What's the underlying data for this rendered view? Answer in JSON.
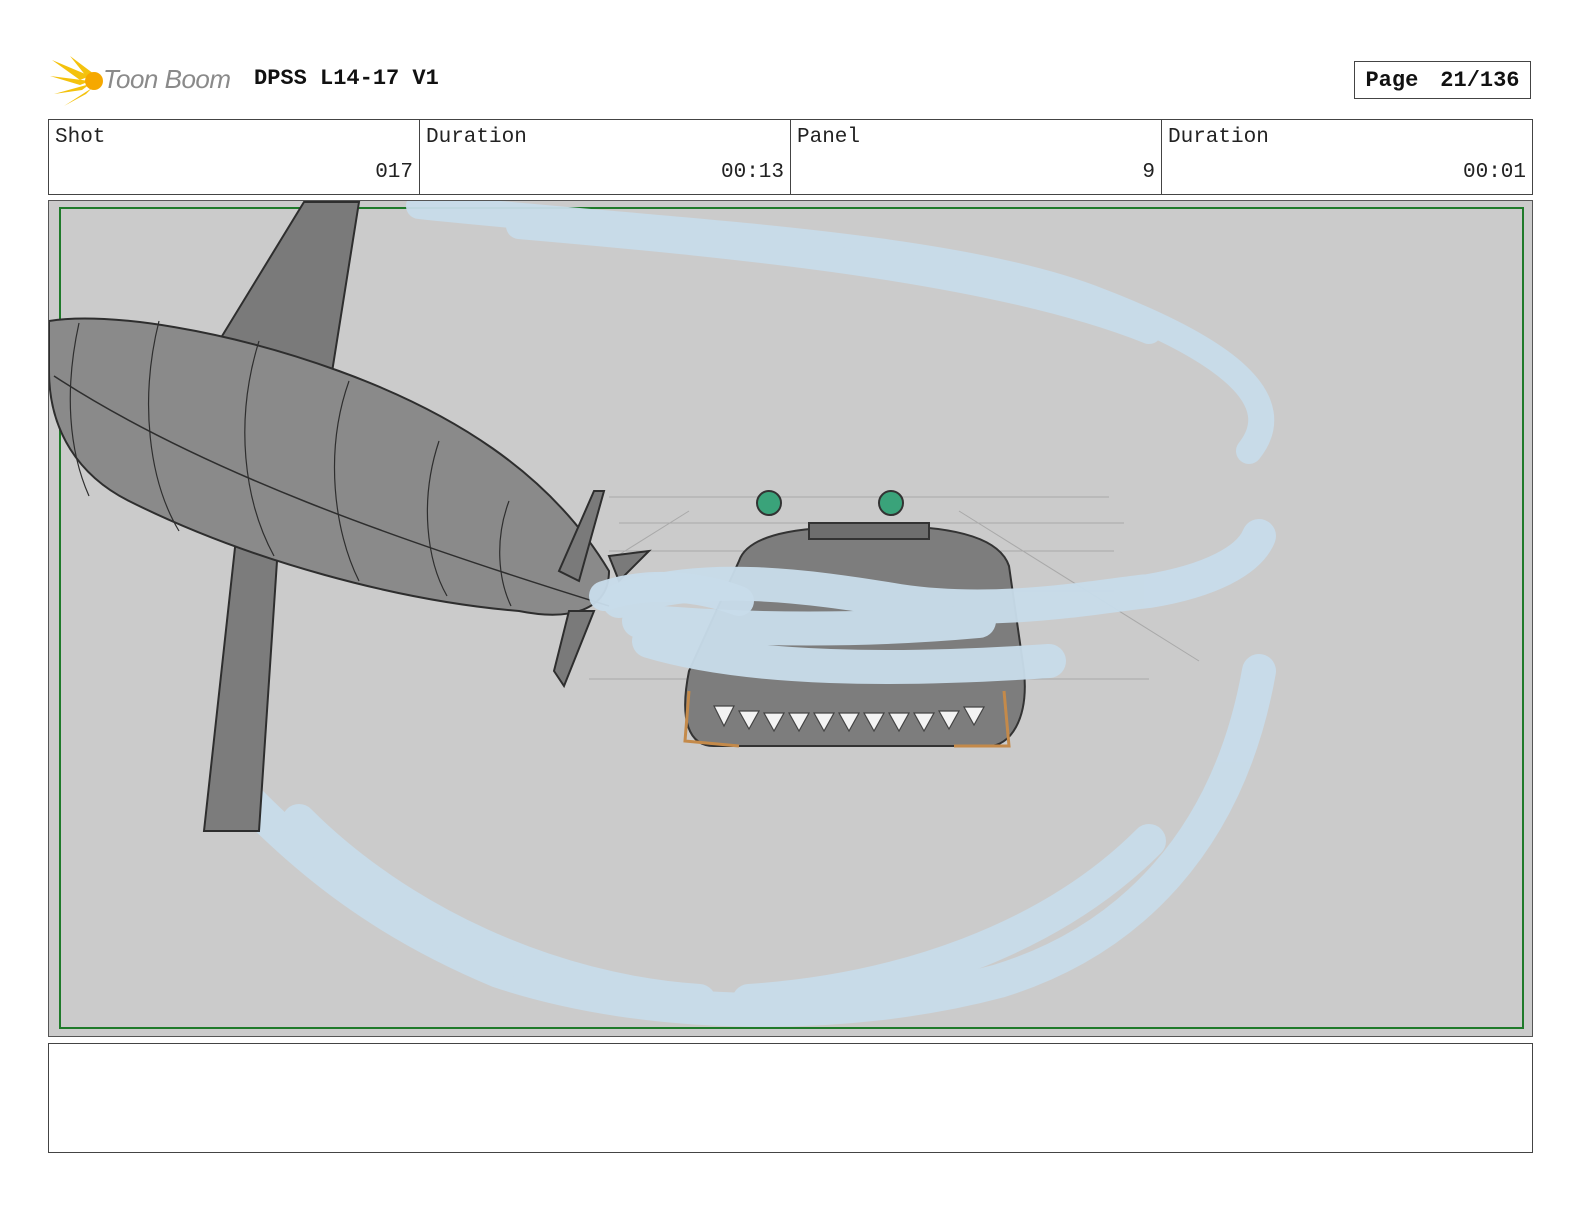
{
  "header": {
    "logo_text": "Toon Boom",
    "project_title": "DPSS L14-17 V1",
    "page_label": "Page",
    "page_value": "21/136"
  },
  "info": {
    "shot_label": "Shot",
    "shot_value": "017",
    "shot_duration_label": "Duration",
    "shot_duration_value": "00:13",
    "panel_label": "Panel",
    "panel_value": "9",
    "panel_duration_label": "Duration",
    "panel_duration_value": "00:01"
  },
  "notes": {
    "text": ""
  }
}
